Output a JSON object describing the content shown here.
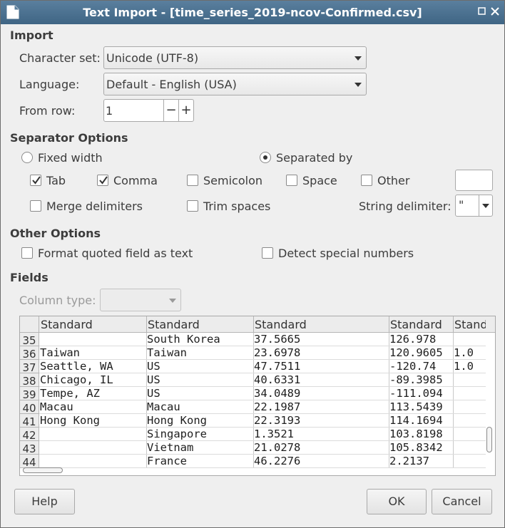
{
  "window": {
    "title": "Text Import - [time_series_2019-ncov-Confirmed.csv]"
  },
  "import": {
    "heading": "Import",
    "charset_label": "Character set:",
    "charset_value": "Unicode (UTF-8)",
    "language_label": "Language:",
    "language_value": "Default - English (USA)",
    "from_row_label": "From row:",
    "from_row_value": "1",
    "minus": "−",
    "plus": "+"
  },
  "separator": {
    "heading": "Separator Options",
    "fixed_width": "Fixed width",
    "fixed_width_selected": false,
    "separated_by": "Separated by",
    "separated_by_selected": true,
    "tab": "Tab",
    "tab_checked": true,
    "comma": "Comma",
    "comma_checked": true,
    "semicolon": "Semicolon",
    "semicolon_checked": false,
    "space": "Space",
    "space_checked": false,
    "other": "Other",
    "other_checked": false,
    "other_value": "",
    "merge": "Merge delimiters",
    "merge_checked": false,
    "trim": "Trim spaces",
    "trim_checked": false,
    "string_delim_label": "String delimiter:",
    "string_delim_value": "\""
  },
  "other_options": {
    "heading": "Other Options",
    "format_quoted": "Format quoted field as text",
    "detect_special": "Detect special numbers"
  },
  "fields": {
    "heading": "Fields",
    "column_type_label": "Column type:",
    "column_type_value": "",
    "headers": [
      "Standard",
      "Standard",
      "Standard",
      "Standard",
      "Standard"
    ],
    "rows": [
      {
        "n": "35",
        "c": [
          "",
          "South Korea",
          "37.5665",
          "126.978",
          ""
        ]
      },
      {
        "n": "36",
        "c": [
          "Taiwan",
          "Taiwan",
          "23.6978",
          "120.9605",
          "1.0"
        ]
      },
      {
        "n": "37",
        "c": [
          "Seattle, WA",
          "US",
          "47.7511",
          "-120.74",
          "1.0"
        ]
      },
      {
        "n": "38",
        "c": [
          "Chicago, IL",
          "US",
          "40.6331",
          "-89.3985",
          ""
        ]
      },
      {
        "n": "39",
        "c": [
          "Tempe, AZ",
          "US",
          "34.0489",
          "-111.094",
          ""
        ]
      },
      {
        "n": "40",
        "c": [
          "Macau",
          "Macau",
          "22.1987",
          "113.5439",
          ""
        ]
      },
      {
        "n": "41",
        "c": [
          "Hong Kong",
          "Hong Kong",
          "22.3193",
          "114.1694",
          ""
        ]
      },
      {
        "n": "42",
        "c": [
          "",
          "Singapore",
          "1.3521",
          "103.8198",
          ""
        ]
      },
      {
        "n": "43",
        "c": [
          "",
          "Vietnam",
          "21.0278",
          "105.8342",
          ""
        ]
      },
      {
        "n": "44",
        "c": [
          "",
          "France",
          "46.2276",
          "2.2137",
          ""
        ]
      }
    ]
  },
  "buttons": {
    "help": "Help",
    "ok": "OK",
    "cancel": "Cancel"
  }
}
